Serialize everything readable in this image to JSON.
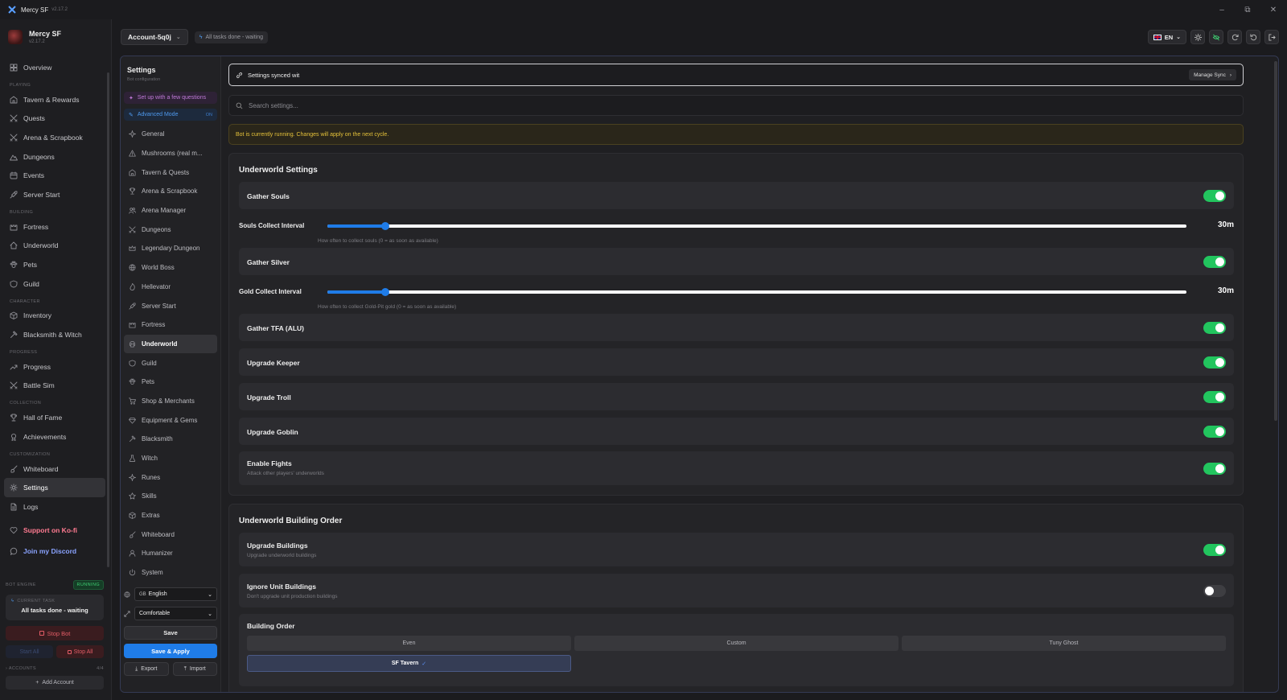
{
  "app": {
    "title": "Mercy SF",
    "version": "v2.17.2"
  },
  "window": {
    "minimize": "–",
    "restore": "⧉",
    "close": "✕"
  },
  "sidebar": {
    "sections": [
      {
        "label": "",
        "items": [
          {
            "label": "Overview",
            "icon": "grid-icon"
          }
        ]
      },
      {
        "label": "PLAYING",
        "items": [
          {
            "label": "Tavern & Rewards",
            "icon": "tavern-icon"
          },
          {
            "label": "Quests",
            "icon": "swords-icon"
          },
          {
            "label": "Arena & Scrapbook",
            "icon": "swords-icon"
          },
          {
            "label": "Dungeons",
            "icon": "mountain-icon"
          },
          {
            "label": "Events",
            "icon": "calendar-icon"
          },
          {
            "label": "Server Start",
            "icon": "rocket-icon"
          }
        ]
      },
      {
        "label": "BUILDING",
        "items": [
          {
            "label": "Fortress",
            "icon": "castle-icon"
          },
          {
            "label": "Underworld",
            "icon": "home-icon"
          },
          {
            "label": "Pets",
            "icon": "paw-icon"
          },
          {
            "label": "Guild",
            "icon": "shield-icon"
          }
        ]
      },
      {
        "label": "CHARACTER",
        "items": [
          {
            "label": "Inventory",
            "icon": "box-icon"
          },
          {
            "label": "Blacksmith & Witch",
            "icon": "hammer-icon"
          }
        ]
      },
      {
        "label": "PROGRESS",
        "items": [
          {
            "label": "Progress",
            "icon": "trend-icon"
          },
          {
            "label": "Battle Sim",
            "icon": "swords-icon"
          }
        ]
      },
      {
        "label": "COLLECTION",
        "items": [
          {
            "label": "Hall of Fame",
            "icon": "trophy-icon"
          },
          {
            "label": "Achievements",
            "icon": "award-icon"
          }
        ]
      },
      {
        "label": "CUSTOMIZATION",
        "items": [
          {
            "label": "Whiteboard",
            "icon": "brush-icon"
          },
          {
            "label": "Settings",
            "icon": "gear-icon",
            "active": true
          },
          {
            "label": "Logs",
            "icon": "file-icon"
          }
        ]
      }
    ],
    "kofi": "Support on Ko-fi",
    "discord": "Join my Discord",
    "engine": {
      "label": "BOT ENGINE",
      "status": "RUNNING",
      "current_task_label": "CURRENT TASK",
      "current_task": "All tasks done - waiting",
      "stop_bot": "Stop Bot",
      "start_all": "Start All",
      "stop_all": "Stop All",
      "accounts_label": "ACCOUNTS",
      "accounts_count": "4/4",
      "add_account": "Add Account"
    }
  },
  "header": {
    "account": "Account-5q0j",
    "status": "All tasks done - waiting",
    "lang": "EN",
    "accent": "#1f7ce8"
  },
  "settings_nav": {
    "title": "Settings",
    "subtitle": "Bot configuration",
    "setup": "Set up with a few questions",
    "advanced": "Advanced Mode",
    "advanced_state": "ON",
    "items": [
      {
        "label": "General",
        "icon": "spark-icon"
      },
      {
        "label": "Mushrooms (real m...",
        "icon": "warning-icon"
      },
      {
        "label": "Tavern & Quests",
        "icon": "tavern-icon"
      },
      {
        "label": "Arena & Scrapbook",
        "icon": "trophy-icon"
      },
      {
        "label": "Arena Manager",
        "icon": "users-icon"
      },
      {
        "label": "Dungeons",
        "icon": "swords-icon"
      },
      {
        "label": "Legendary Dungeon",
        "icon": "crown-icon"
      },
      {
        "label": "World Boss",
        "icon": "globe-icon"
      },
      {
        "label": "Hellevator",
        "icon": "flame-icon"
      },
      {
        "label": "Server Start",
        "icon": "rocket-icon"
      },
      {
        "label": "Fortress",
        "icon": "castle-icon"
      },
      {
        "label": "Underworld",
        "icon": "skull-icon",
        "active": true
      },
      {
        "label": "Guild",
        "icon": "shield-icon"
      },
      {
        "label": "Pets",
        "icon": "paw-icon"
      },
      {
        "label": "Shop & Merchants",
        "icon": "cart-icon"
      },
      {
        "label": "Equipment & Gems",
        "icon": "gem-icon"
      },
      {
        "label": "Blacksmith",
        "icon": "hammer-icon"
      },
      {
        "label": "Witch",
        "icon": "flask-icon"
      },
      {
        "label": "Runes",
        "icon": "spark-icon"
      },
      {
        "label": "Skills",
        "icon": "star-icon"
      },
      {
        "label": "Extras",
        "icon": "box-icon"
      },
      {
        "label": "Whiteboard",
        "icon": "brush-icon"
      },
      {
        "label": "Humanizer",
        "icon": "user-icon"
      },
      {
        "label": "System",
        "icon": "power-icon"
      }
    ],
    "language": "English",
    "language_flag": "GB",
    "density": "Comfortable",
    "save": "Save",
    "save_apply": "Save & Apply",
    "export": "Export",
    "import": "Import"
  },
  "main": {
    "sync_text": "Settings synced wit",
    "manage_sync": "Manage Sync",
    "search_placeholder": "Search settings...",
    "warning": "Bot is currently running. Changes will apply on the next cycle.",
    "underworld": {
      "title": "Underworld Settings",
      "gather_souls": {
        "label": "Gather Souls",
        "on": true
      },
      "souls_interval": {
        "label": "Souls Collect Interval",
        "value": "30m",
        "fraction": 0.067,
        "desc": "How often to collect souls (0 = as soon as available)"
      },
      "gather_silver": {
        "label": "Gather Silver",
        "on": true
      },
      "gold_interval": {
        "label": "Gold Collect Interval",
        "value": "30m",
        "fraction": 0.067,
        "desc": "How often to collect Gold-Pit gold (0 = as soon as available)"
      },
      "gather_tfa": {
        "label": "Gather TFA (ALU)",
        "on": true
      },
      "upgrade_keeper": {
        "label": "Upgrade Keeper",
        "on": true
      },
      "upgrade_troll": {
        "label": "Upgrade Troll",
        "on": true
      },
      "upgrade_goblin": {
        "label": "Upgrade Goblin",
        "on": true
      },
      "enable_fights": {
        "label": "Enable Fights",
        "desc": "Attack other players' underworlds",
        "on": true
      }
    },
    "building_order": {
      "title": "Underworld Building Order",
      "upgrade_buildings": {
        "label": "Upgrade Buildings",
        "desc": "Upgrade underworld buildings",
        "on": true
      },
      "ignore_unit": {
        "label": "Ignore Unit Buildings",
        "desc": "Don't upgrade unit production buildings",
        "on": false
      },
      "order_label": "Building Order",
      "options": [
        "Even",
        "Custom",
        "Tuny Ghost"
      ],
      "selected": "SF Tavern"
    }
  }
}
